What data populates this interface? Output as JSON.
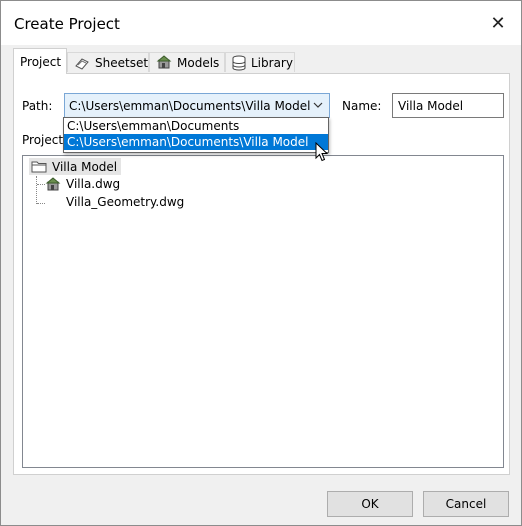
{
  "window": {
    "title": "Create Project",
    "close_symbol": "✕"
  },
  "tabs": [
    {
      "label": "Project",
      "icon": "none",
      "active": true
    },
    {
      "label": "Sheetset",
      "icon": "sheetset-icon"
    },
    {
      "label": "Models",
      "icon": "models-icon"
    },
    {
      "label": "Library",
      "icon": "database-icon"
    }
  ],
  "form": {
    "path_label": "Path:",
    "path_value": "C:\\Users\\emman\\Documents\\Villa Model",
    "name_label": "Name:",
    "name_value": "Villa Model",
    "project_label": "Project"
  },
  "dropdown": {
    "options": [
      "C:\\Users\\emman\\Documents",
      "C:\\Users\\emman\\Documents\\Villa Model"
    ],
    "selected_index": 1
  },
  "tree": {
    "root": "Villa Model",
    "children": [
      "Villa.dwg",
      "Villa_Geometry.dwg"
    ]
  },
  "buttons": {
    "ok": "OK",
    "cancel": "Cancel"
  },
  "colors": {
    "selection": "#0078d7",
    "combo_bg": "#e5f1fb"
  }
}
